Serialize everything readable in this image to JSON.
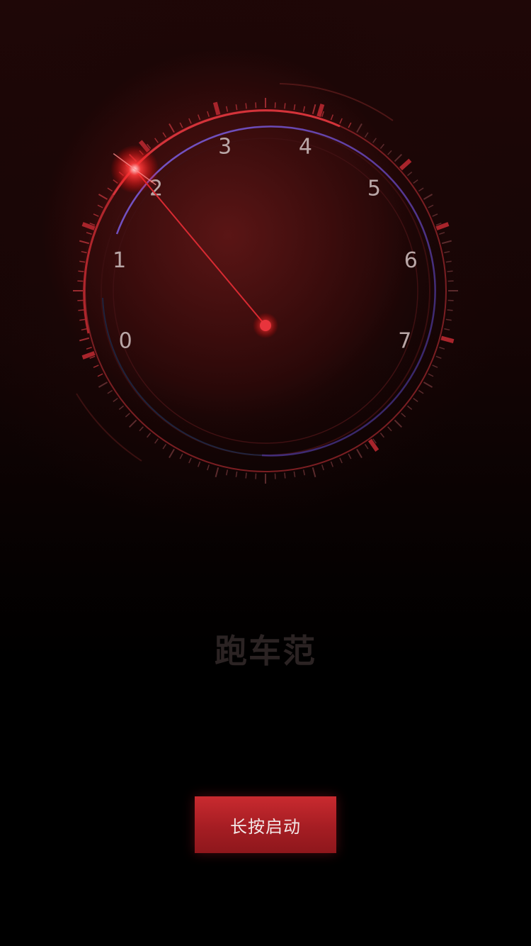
{
  "gauge": {
    "numbers": [
      "0",
      "1",
      "2",
      "3",
      "4",
      "5",
      "6",
      "7"
    ],
    "needle_value": 2.0,
    "accent_color": "#e8343c",
    "arc_color": "#6b4fb5"
  },
  "brand": {
    "title": "跑车范"
  },
  "start_button": {
    "label": "长按启动"
  }
}
